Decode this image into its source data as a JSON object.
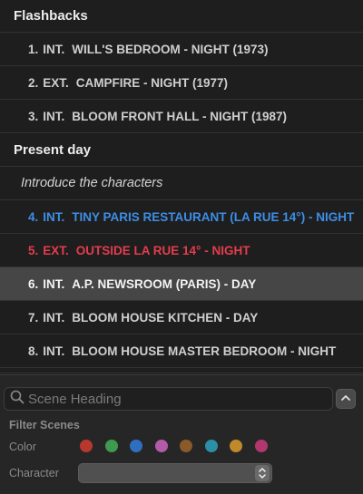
{
  "outline": {
    "sections": [
      {
        "title": "Flashbacks"
      },
      {
        "title": "Present day"
      }
    ],
    "note": "Introduce the characters",
    "scenes": [
      {
        "num": "1.",
        "ie": "INT.",
        "heading": "WILL'S BEDROOM - NIGHT (1973)"
      },
      {
        "num": "2.",
        "ie": "EXT.",
        "heading": "CAMPFIRE - NIGHT (1977)"
      },
      {
        "num": "3.",
        "ie": "INT.",
        "heading": "BLOOM FRONT HALL - NIGHT (1987)"
      },
      {
        "num": "4.",
        "ie": "INT.",
        "heading": "TINY PARIS RESTAURANT (LA RUE 14°) - NIGHT",
        "color": "#3d8ee6"
      },
      {
        "num": "5.",
        "ie": "EXT.",
        "heading": "OUTSIDE LA RUE 14° - NIGHT",
        "color": "#e43c4d"
      },
      {
        "num": "6.",
        "ie": "INT.",
        "heading": "A.P. NEWSROOM (PARIS) - DAY",
        "selected": true
      },
      {
        "num": "7.",
        "ie": "INT.",
        "heading": "BLOOM HOUSE KITCHEN - DAY"
      },
      {
        "num": "8.",
        "ie": "INT.",
        "heading": "BLOOM HOUSE MASTER BEDROOM - NIGHT"
      }
    ]
  },
  "filter": {
    "search_placeholder": "Scene Heading",
    "title": "Filter Scenes",
    "color_label": "Color",
    "character_label": "Character",
    "character_value": "",
    "colors": [
      "#b8382e",
      "#3e9a4f",
      "#2f6fc0",
      "#b35aa8",
      "#8a5a2a",
      "#2b8fa8",
      "#c08a2a",
      "#b0386e"
    ],
    "icons": {
      "search": "magnifier-icon",
      "collapse": "chevron-up-icon",
      "select": "up-down-chevron-icon"
    }
  }
}
